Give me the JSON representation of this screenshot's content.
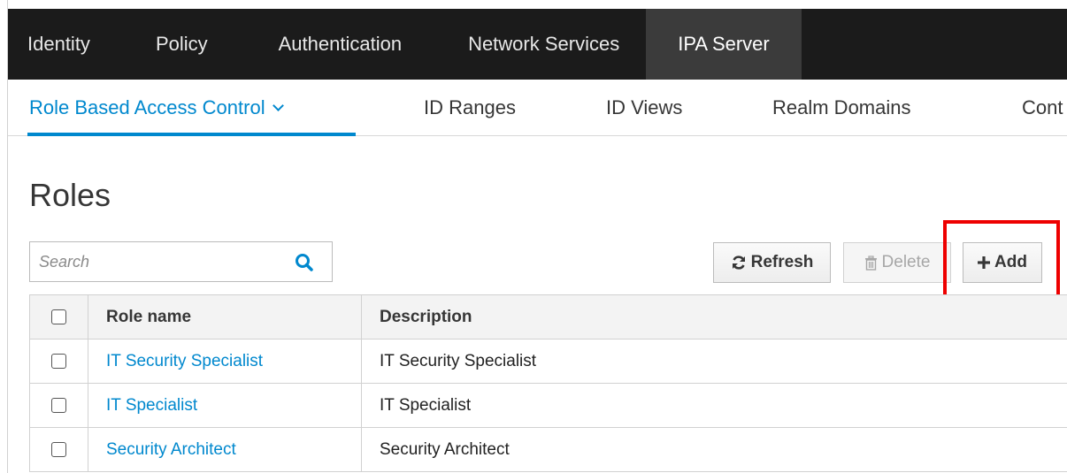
{
  "top_nav": {
    "items": [
      {
        "label": "Identity"
      },
      {
        "label": "Policy"
      },
      {
        "label": "Authentication"
      },
      {
        "label": "Network Services"
      },
      {
        "label": "IPA Server",
        "active": true
      }
    ]
  },
  "sub_nav": {
    "items": [
      {
        "label": "Role Based Access Control",
        "active": true
      },
      {
        "label": "ID Ranges"
      },
      {
        "label": "ID Views"
      },
      {
        "label": "Realm Domains"
      },
      {
        "label": "Cont"
      }
    ]
  },
  "page": {
    "title": "Roles"
  },
  "search": {
    "placeholder": "Search"
  },
  "toolbar": {
    "refresh_label": "Refresh",
    "delete_label": "Delete",
    "add_label": "Add"
  },
  "table": {
    "columns": [
      "Role name",
      "Description"
    ],
    "rows": [
      {
        "name": "IT Security Specialist",
        "description": "IT Security Specialist"
      },
      {
        "name": "IT Specialist",
        "description": "IT Specialist"
      },
      {
        "name": "Security Architect",
        "description": "Security Architect"
      }
    ]
  },
  "colors": {
    "accent": "#0088ce",
    "highlight": "#ee0000",
    "nav_bg": "#1b1b1b"
  }
}
